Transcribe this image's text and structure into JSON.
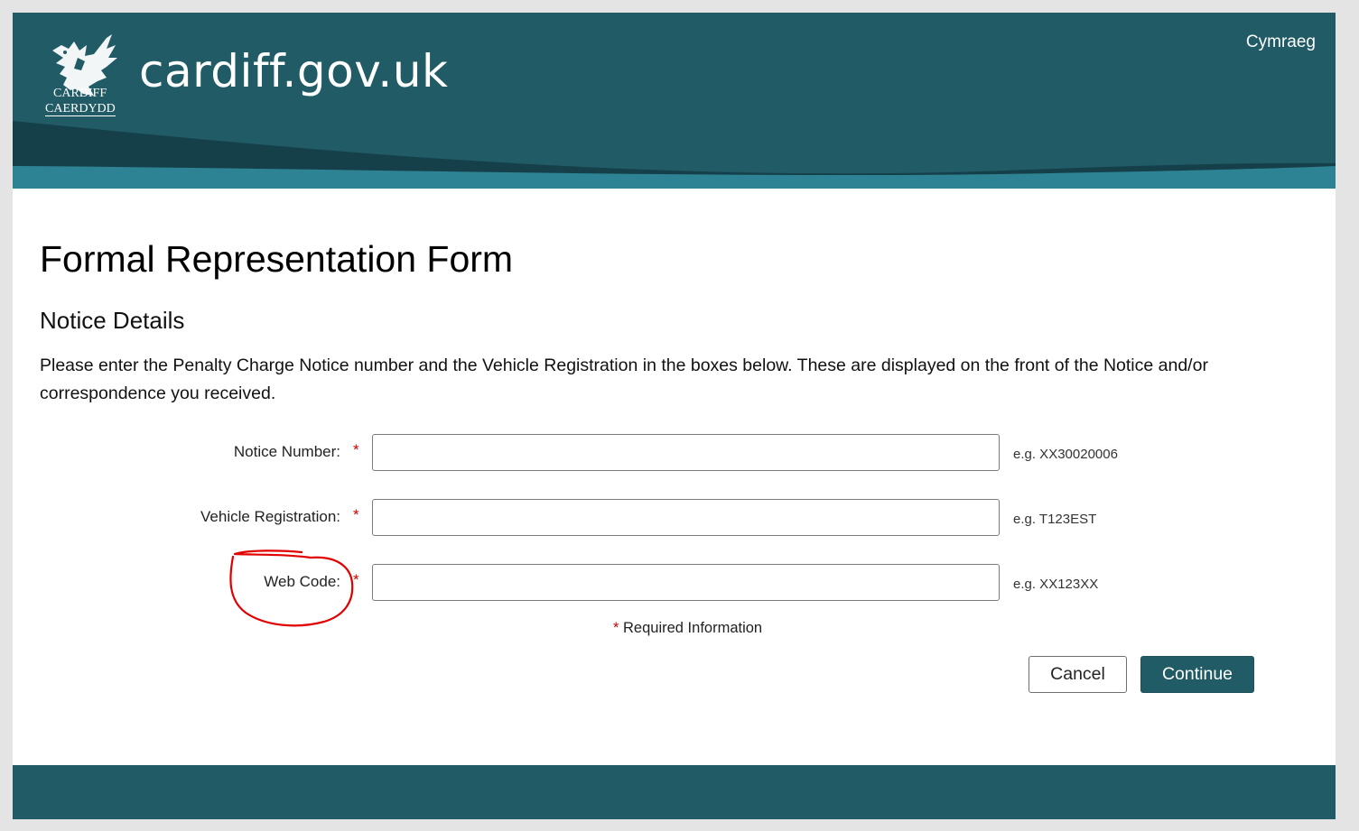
{
  "header": {
    "logo_line1": "CARDIFF",
    "logo_line2": "CAERDYDD",
    "site_name": "cardiff.gov.uk",
    "language_link": "Cymraeg"
  },
  "page": {
    "title": "Formal Representation Form",
    "section_title": "Notice Details",
    "intro": "Please enter the Penalty Charge Notice number and the Vehicle Registration in the boxes below. These are displayed on the front of the Notice and/or correspondence you received."
  },
  "form": {
    "required_marker": "*",
    "fields": [
      {
        "label": "Notice Number:",
        "value": "",
        "hint": "e.g. XX30020006"
      },
      {
        "label": "Vehicle Registration:",
        "value": "",
        "hint": "e.g. T123EST"
      },
      {
        "label": "Web Code:",
        "value": "",
        "hint": "e.g. XX123XX"
      }
    ],
    "required_info": "Required Information",
    "cancel_label": "Cancel",
    "continue_label": "Continue"
  },
  "colors": {
    "brand_teal": "#205b66",
    "wave_dark": "#15404a",
    "wave_light": "#2d8293",
    "required_red": "#cc0000",
    "annotation_red": "#e00000"
  },
  "icons": {
    "logo": "cardiff-dragon-emblem-icon"
  }
}
